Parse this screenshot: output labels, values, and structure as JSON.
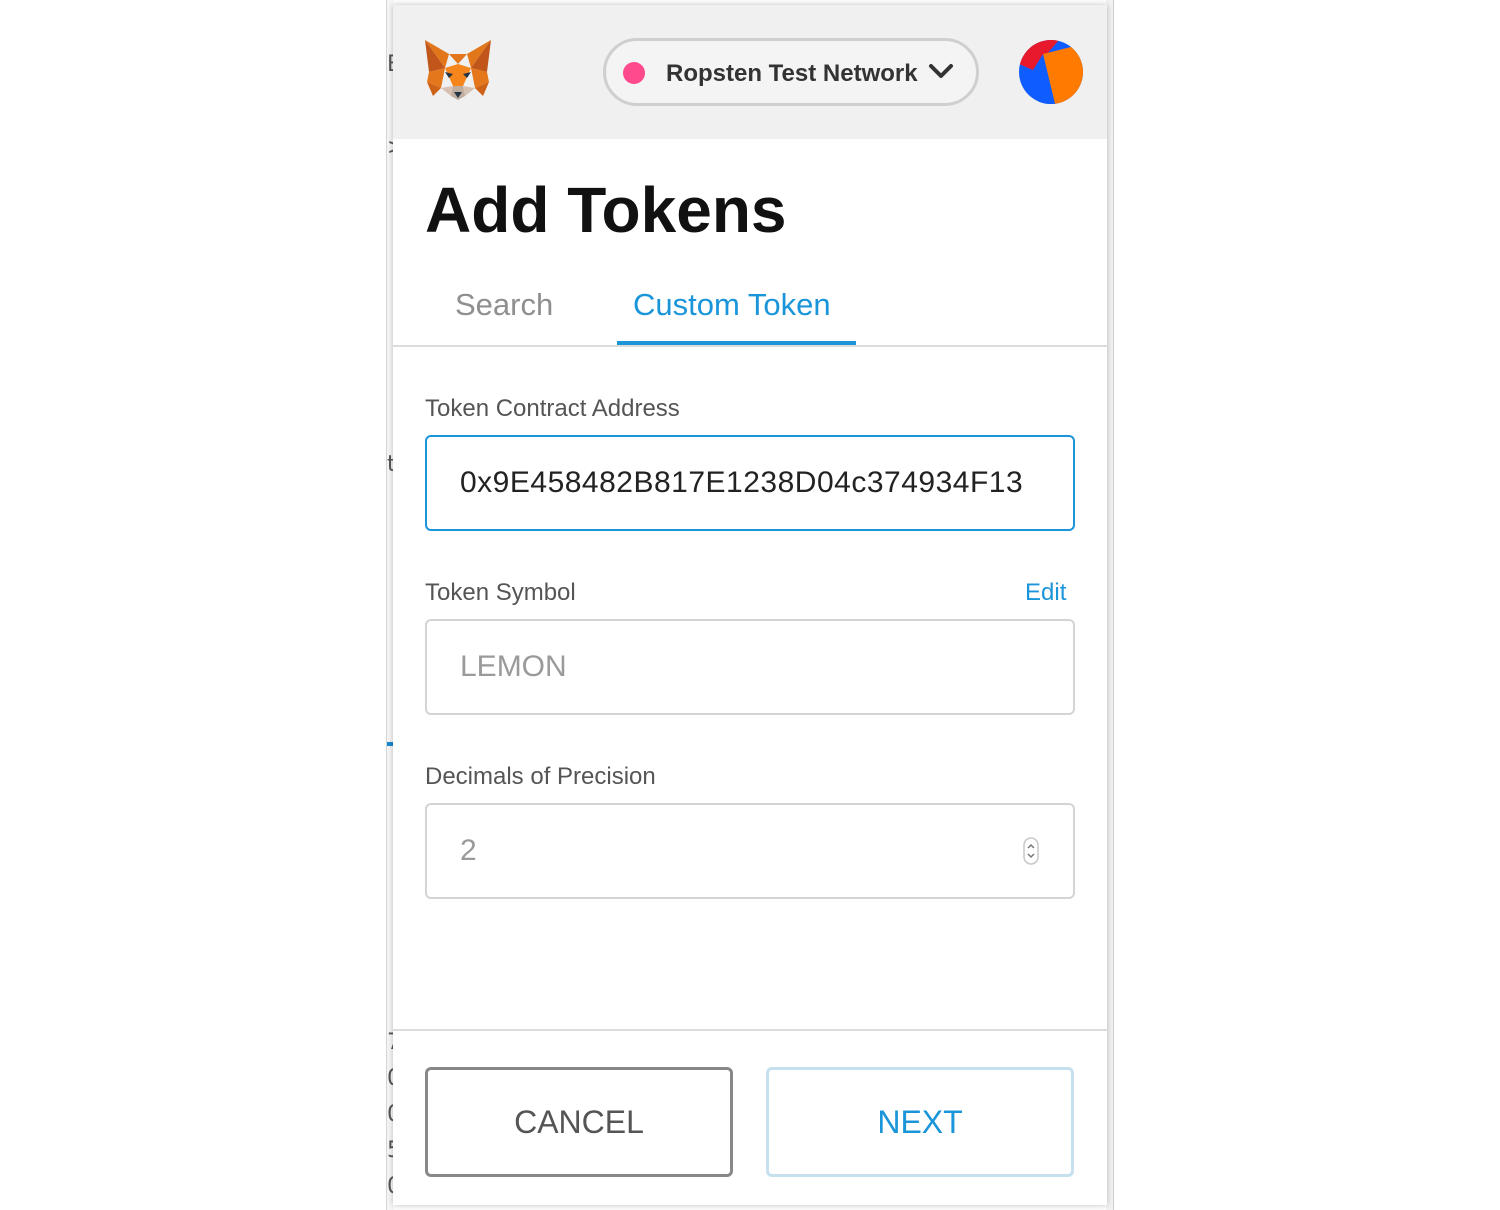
{
  "header": {
    "logo_icon": "metamask-fox-icon",
    "network": {
      "label": "Ropsten Test Network",
      "status_color": "#ff4a8d",
      "dropdown_icon": "chevron-down-icon"
    },
    "account_icon": "account-avatar-icon"
  },
  "page": {
    "title": "Add Tokens",
    "tabs": [
      {
        "label": "Search",
        "active": false
      },
      {
        "label": "Custom Token",
        "active": true
      }
    ]
  },
  "form": {
    "contract_address": {
      "label": "Token Contract Address",
      "value": "0x9E458482B817E1238D04c374934F13"
    },
    "token_symbol": {
      "label": "Token Symbol",
      "edit_label": "Edit",
      "value": "LEMON"
    },
    "decimals": {
      "label": "Decimals of Precision",
      "value": "2"
    }
  },
  "footer": {
    "cancel_label": "CANCEL",
    "next_label": "NEXT"
  },
  "colors": {
    "accent": "#1b95d9",
    "header_bg": "#f0f0f0",
    "network_dot": "#ff4a8d"
  }
}
